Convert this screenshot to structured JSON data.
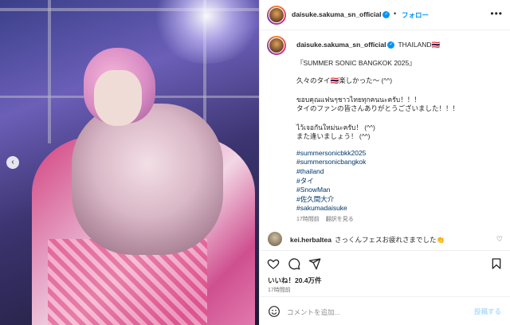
{
  "post": {
    "username": "daisuke.sakuma_sn_official",
    "follow_label": "フォロー",
    "dot": "•",
    "location": "THAILAND🇹🇭"
  },
  "caption": {
    "lines": [
      "『SUMMER SONIC BANGKOK 2025』",
      "久々のタイ🇹🇭楽しかった〜 (^^)",
      "ขอบคุณแฟนๆชาวไทยทุกคนนะครับ！！！",
      "タイのファンの皆さんありがとうございました！！！",
      "ไว้เจอกันใหม่นะครับ！ (^^)",
      "また逢いましょう！ (^^)"
    ],
    "hashtags": [
      "#summersonicbkk2025",
      "#summersonicbangkok",
      "#thailand",
      "#タイ",
      "#SnowMan",
      "#佐久間大介",
      "#sakumadaisuke"
    ],
    "time": "17時間前",
    "translate_label": "翻訳を見る"
  },
  "comment": {
    "username": "kei.herbaltea",
    "text": "さっくんフェスお疲れさまでした👏"
  },
  "actions": {
    "likes": "いいね！20.4万件",
    "time": "17時間前"
  },
  "composer": {
    "placeholder": "コメントを追加...",
    "post_label": "投稿する"
  },
  "photo": {
    "nav_prev": "‹"
  },
  "colors": {
    "accent": "#0095f6",
    "hashtag": "#00376b",
    "muted": "#737373"
  }
}
